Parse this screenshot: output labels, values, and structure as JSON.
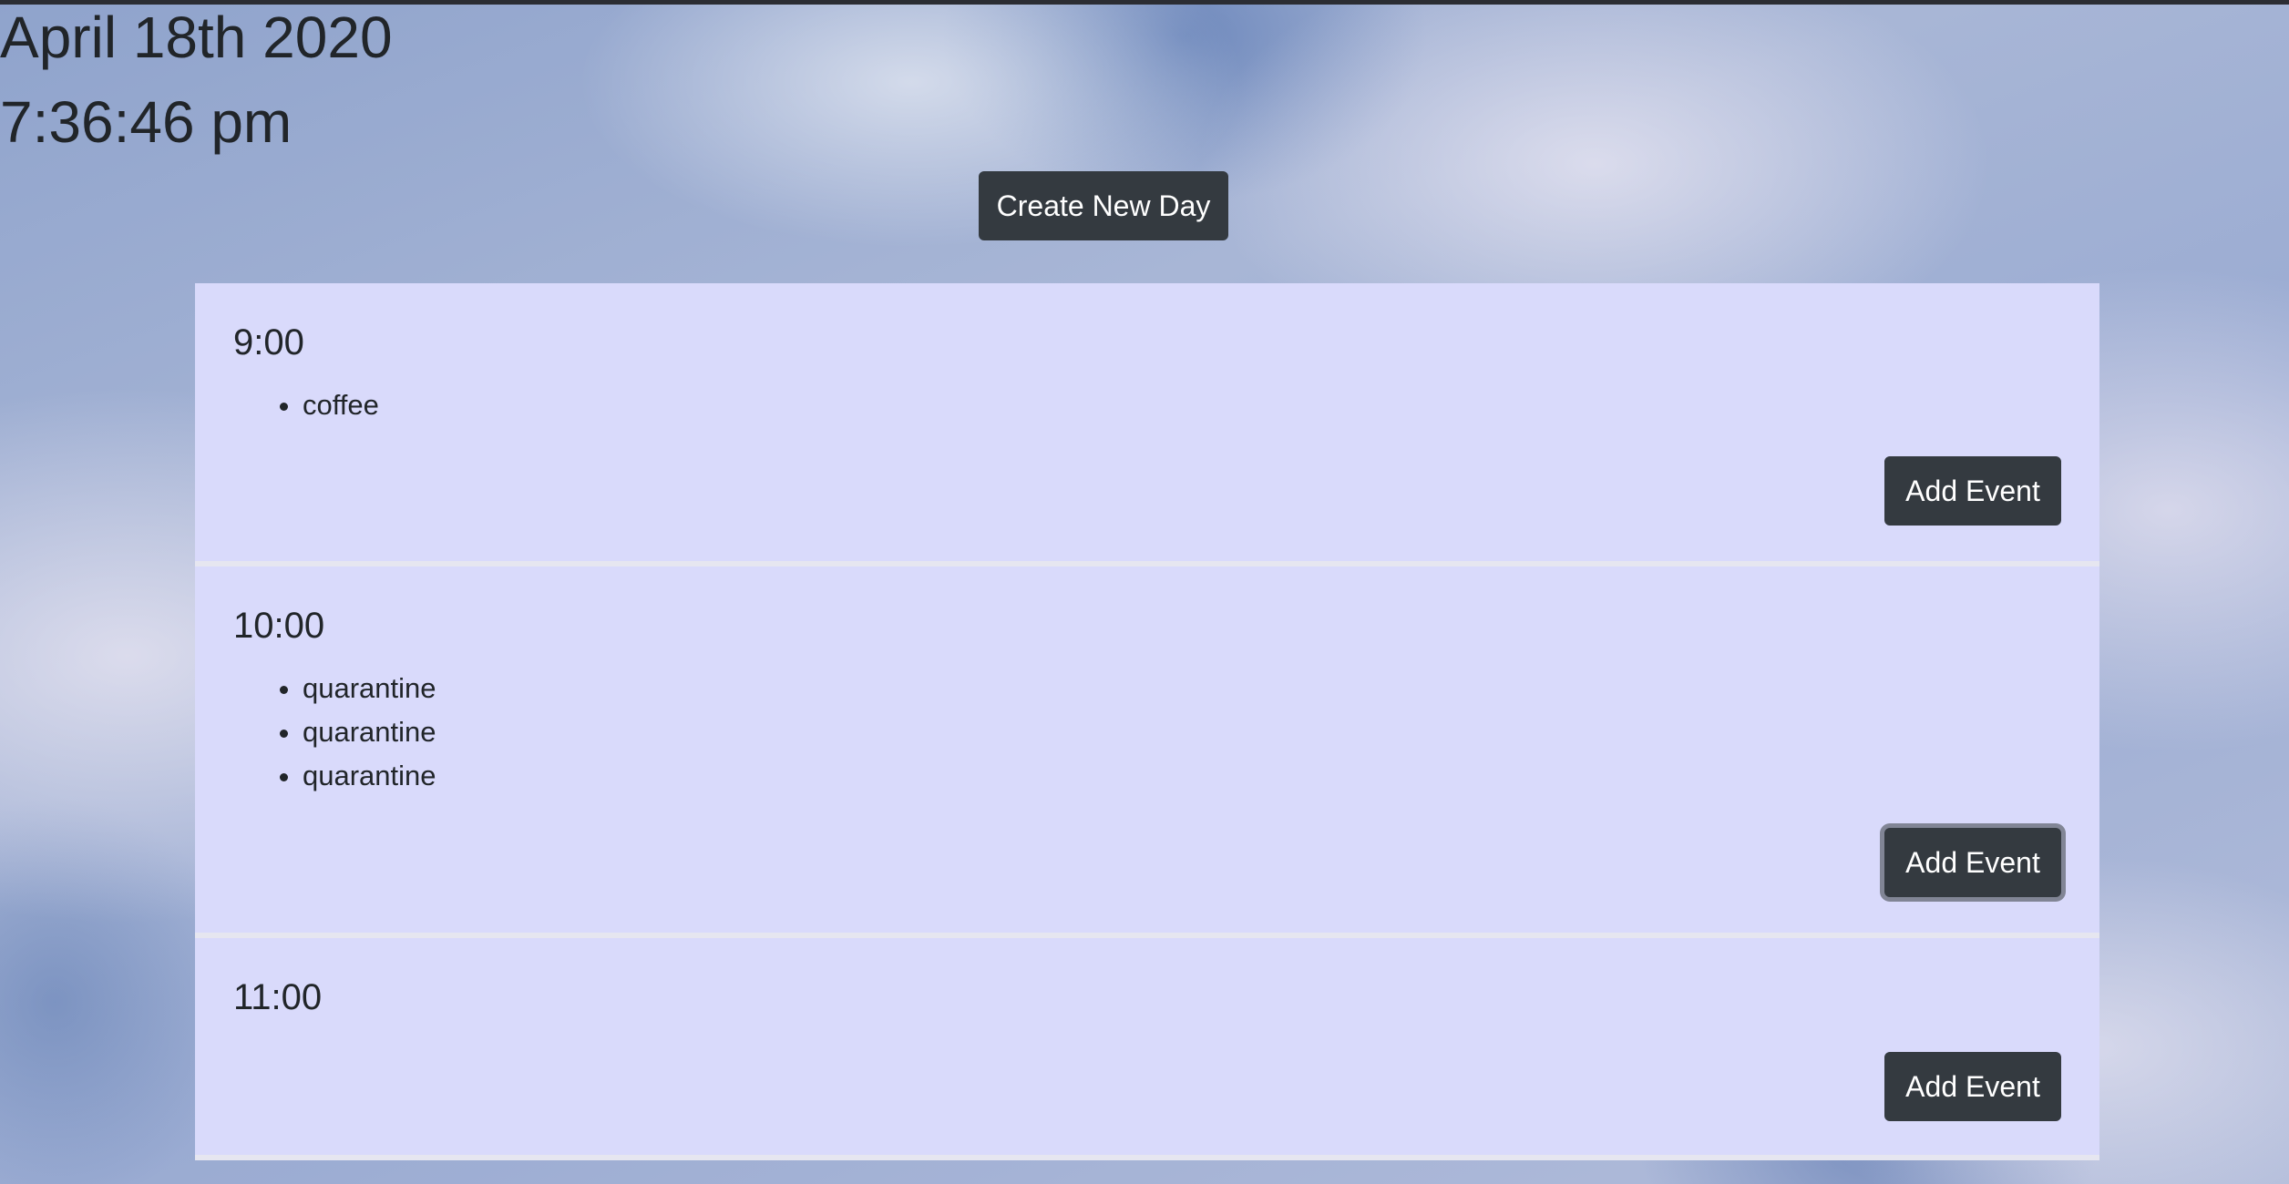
{
  "header": {
    "date": "April 18th 2020",
    "time": "7:36:46 pm"
  },
  "toolbar": {
    "create_day_label": "Create New Day"
  },
  "hours": [
    {
      "label": "9:00",
      "events": [
        "coffee"
      ],
      "add_label": "Add Event"
    },
    {
      "label": "10:00",
      "events": [
        "quarantine",
        "quarantine",
        "quarantine"
      ],
      "add_label": "Add Event"
    },
    {
      "label": "11:00",
      "events": [],
      "add_label": "Add Event"
    }
  ],
  "colors": {
    "card_background": "#d9dafb",
    "button_background": "#343a40",
    "button_text": "#ffffff",
    "text": "#212529"
  }
}
